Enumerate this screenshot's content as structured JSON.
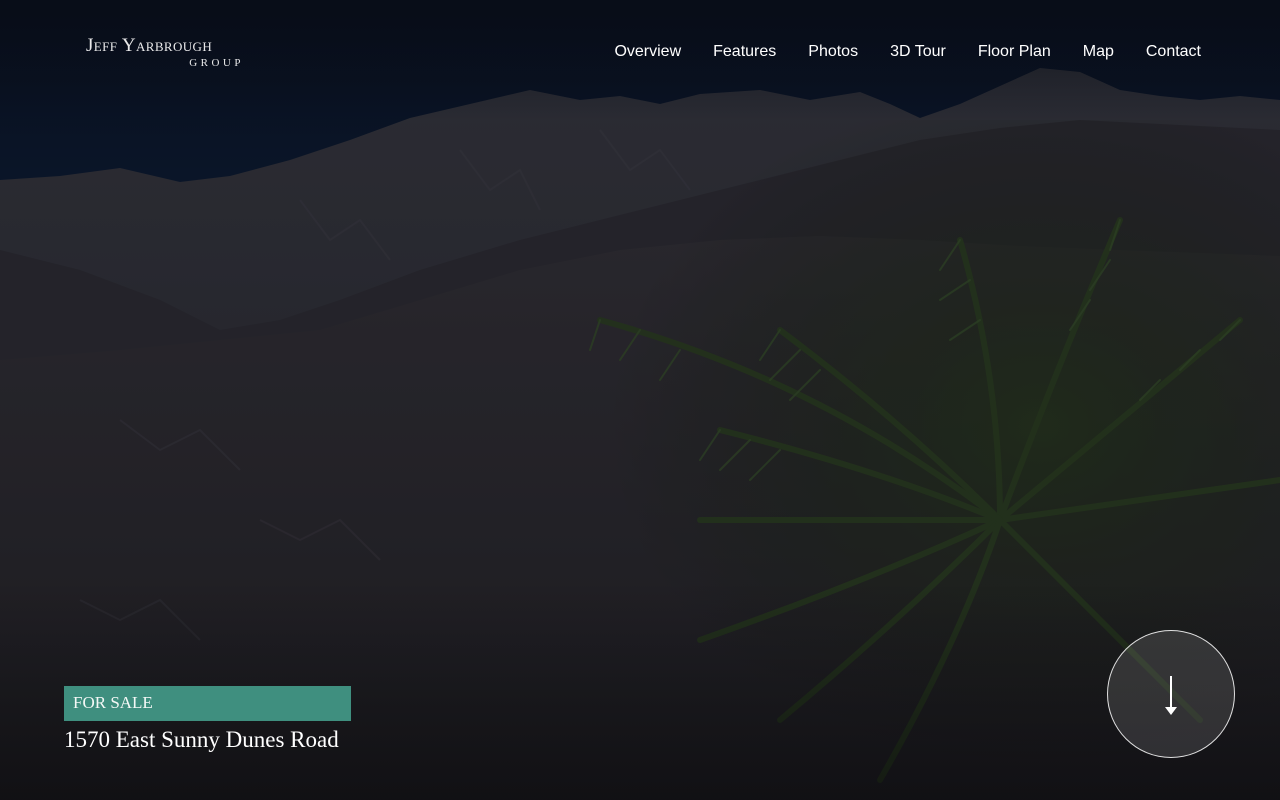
{
  "brand": {
    "name_line1": "Jeff Yarbrough",
    "name_line2": "GROUP"
  },
  "nav": {
    "items": [
      {
        "label": "Overview"
      },
      {
        "label": "Features"
      },
      {
        "label": "Photos"
      },
      {
        "label": "3D Tour"
      },
      {
        "label": "Floor Plan"
      },
      {
        "label": "Map"
      },
      {
        "label": "Contact"
      }
    ]
  },
  "listing": {
    "status": "FOR SALE",
    "address": "1570 East Sunny Dunes Road"
  },
  "scroll": {
    "icon": "arrow-down-icon"
  },
  "colors": {
    "badge": "#3f8f7f",
    "sky": "#13264a",
    "text": "#ffffff"
  }
}
